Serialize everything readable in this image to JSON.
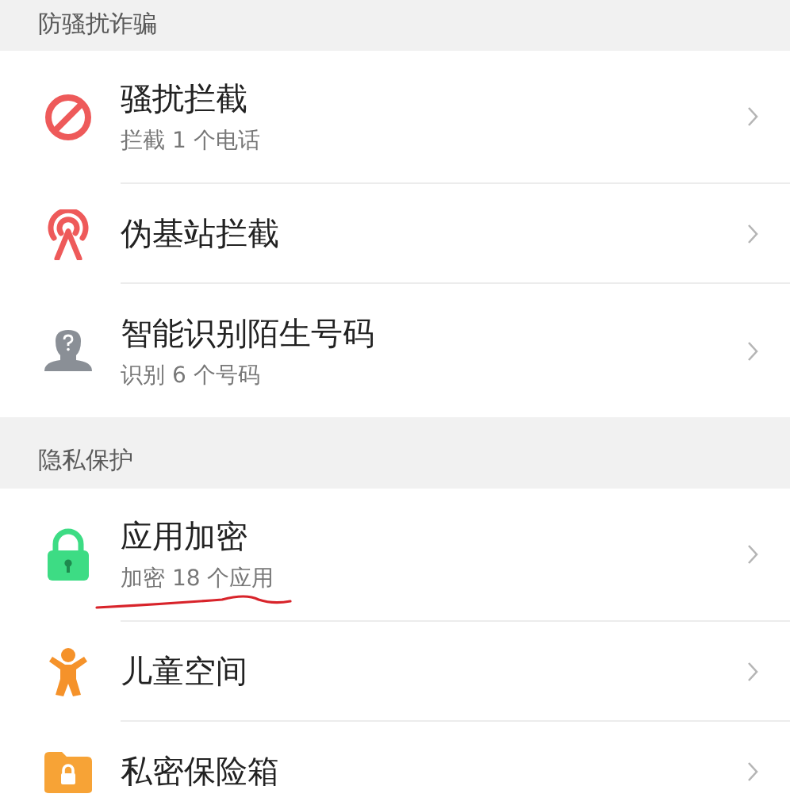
{
  "sections": [
    {
      "title": "防骚扰诈骗",
      "items": [
        {
          "kind": "block",
          "title": "骚扰拦截",
          "subtitle": "拦截 1 个电话",
          "underlined": false
        },
        {
          "kind": "tower",
          "title": "伪基站拦截",
          "underlined": false
        },
        {
          "kind": "person",
          "title": "智能识别陌生号码",
          "subtitle": "识别 6 个号码",
          "underlined": false
        }
      ]
    },
    {
      "title": "隐私保护",
      "items": [
        {
          "kind": "lock",
          "title": "应用加密",
          "subtitle": "加密 18 个应用",
          "underlined": true
        },
        {
          "kind": "child",
          "title": "儿童空间",
          "underlined": false
        },
        {
          "kind": "folder",
          "title": "私密保险箱",
          "underlined": false
        }
      ]
    }
  ]
}
